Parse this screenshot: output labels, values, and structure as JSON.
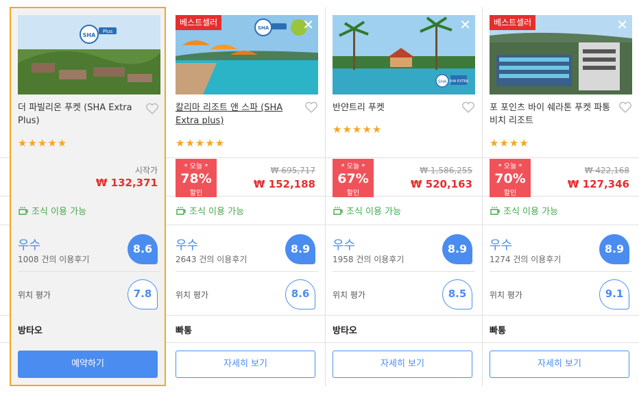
{
  "hotels": [
    {
      "name": "더 파빌리온 푸켓 (SHA Extra Plus)",
      "stars": "★★★★★",
      "from_label": "시작가",
      "price": "₩ 132,371",
      "breakfast": "조식 이용 가능",
      "rating_word": "우수",
      "reviews": "1008 건의 이용후기",
      "score": "8.6",
      "location_label": "위치 평가",
      "location_score": "7.8",
      "area": "방타오",
      "button": "예약하기",
      "photo_logo": "SHA Plus"
    },
    {
      "badge": "베스트셀러",
      "name": "칼리마 리조트 앤 스파 (SHA Extra plus)",
      "stars": "★★★★★",
      "deal_top": "* 오늘 *",
      "deal_pct": "78%",
      "deal_bottom": "할인",
      "old_price": "₩ 695,717",
      "price": "₩ 152,188",
      "breakfast": "조식 이용 가능",
      "rating_word": "우수",
      "reviews": "2643 건의 이용후기",
      "score": "8.9",
      "location_label": "위치 평가",
      "location_score": "8.6",
      "area": "빠통",
      "button": "자세히 보기",
      "photo_logo": "SHA Plus"
    },
    {
      "name": "반얀트리 푸켓",
      "stars": "★★★★★",
      "deal_top": "* 오늘 *",
      "deal_pct": "67%",
      "deal_bottom": "할인",
      "old_price": "₩ 1,586,255",
      "price": "₩ 520,163",
      "breakfast": "조식 이용 가능",
      "rating_word": "우수",
      "reviews": "1958 건의 이용후기",
      "score": "8.9",
      "location_label": "위치 평가",
      "location_score": "8.5",
      "area": "방타오",
      "button": "자세히 보기",
      "photo_logo": "SHA EXTRA"
    },
    {
      "badge": "베스트셀러",
      "name": "포 포인츠 바이 쉐라톤 푸켓 파통 비치 리조트",
      "stars": "★★★★",
      "deal_top": "* 오늘 *",
      "deal_pct": "70%",
      "deal_bottom": "할인",
      "old_price": "₩ 422,168",
      "price": "₩ 127,346",
      "breakfast": "조식 이용 가능",
      "rating_word": "우수",
      "reviews": "1274 건의 이용후기",
      "score": "8.9",
      "location_label": "위치 평가",
      "location_score": "9.1",
      "area": "빠통",
      "button": "자세히 보기"
    }
  ],
  "icons": {
    "close": "✕",
    "heart": "heart-outline-icon",
    "breakfast": "coffee-cup-icon"
  },
  "colors": {
    "accent": "#4a8cf0",
    "price": "#e52e2e",
    "deal": "#f0525a",
    "breakfast": "#45a84a",
    "selected_border": "#f5a623"
  }
}
